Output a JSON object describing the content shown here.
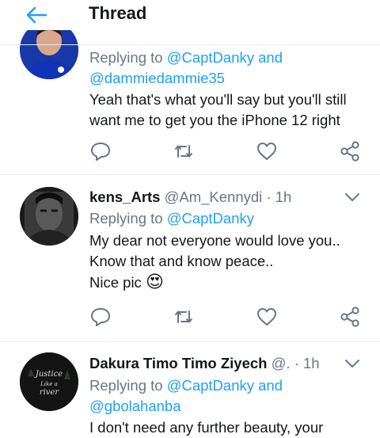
{
  "header": {
    "title": "Thread"
  },
  "tweets": [
    {
      "reply_prefix": "Replying to",
      "reply_to_line1": "@CaptDanky and",
      "reply_to_line2": "@dammiedammie35",
      "text_lines": [
        "Yeah that's what you'll say but you'll still",
        "want me to get you the iPhone 12 right"
      ]
    },
    {
      "display_name": "kens_Arts",
      "handle": "@Am_Kennydi",
      "dot": "·",
      "time": "1h",
      "reply_prefix": "Replying to",
      "reply_to_line1": "@CaptDanky",
      "text_lines": [
        "My dear not everyone would love you..",
        "Know that and know peace..",
        "Nice pic"
      ],
      "emoji": "😍"
    },
    {
      "display_name": "Dakura Timo Timo Ziyech",
      "handle": "@.",
      "dot": "·",
      "time": "1h",
      "reply_prefix": "Replying to",
      "reply_to_line1": "@CaptDanky and",
      "reply_to_line2": "@gbolahanba",
      "text_lines": [
        "I don't need any further beauty,  your"
      ],
      "avatar_text": [
        "Justice",
        "Like a",
        "river"
      ]
    }
  ],
  "colors": {
    "accent": "#1da1f2",
    "icon": "#657786",
    "text": "#14171a",
    "divider": "#e6ecf0"
  },
  "icons": [
    "back-arrow-icon",
    "reply-icon",
    "retweet-icon",
    "like-icon",
    "share-icon",
    "chevron-down-icon"
  ]
}
